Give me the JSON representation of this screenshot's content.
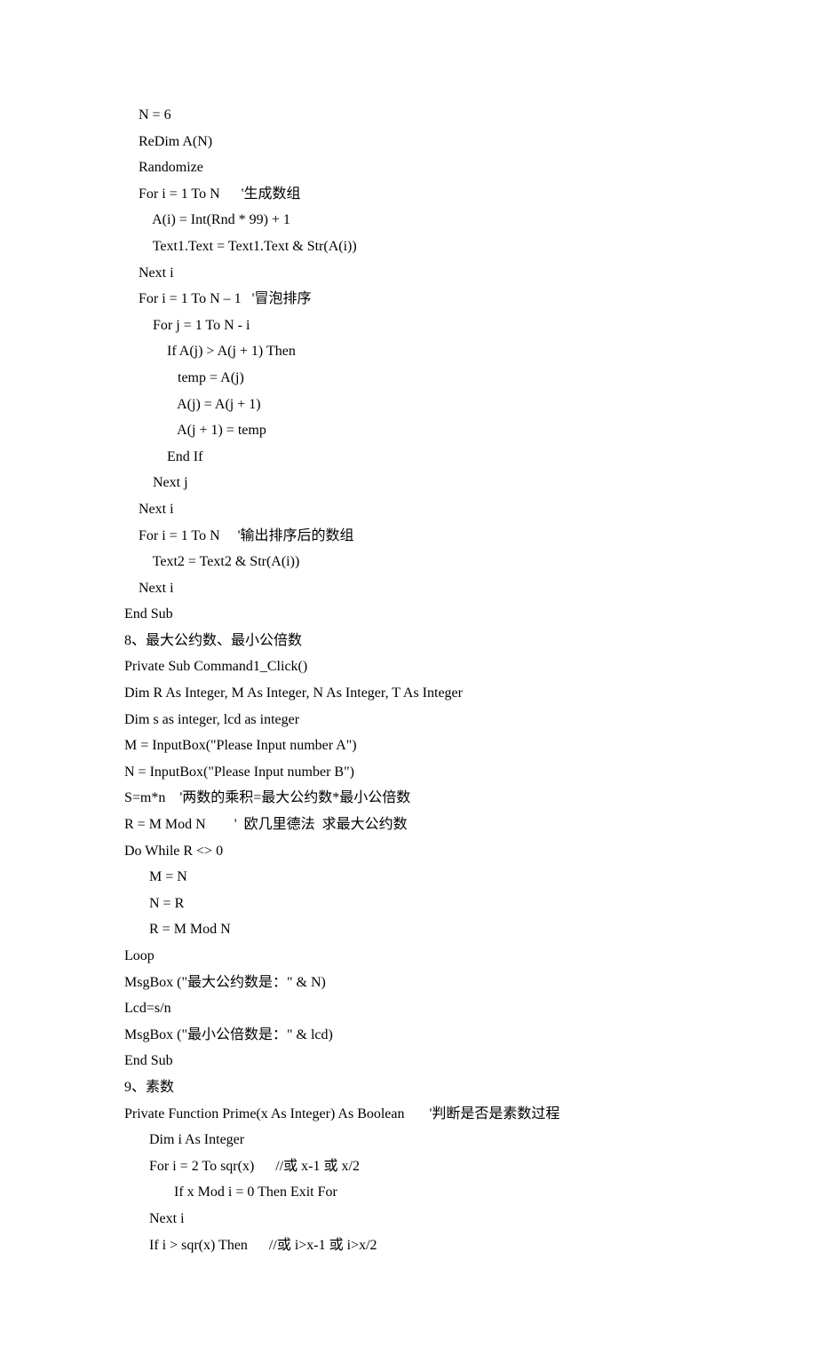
{
  "lines": [
    "    N = 6",
    "    ReDim A(N)",
    "    Randomize",
    "    For i = 1 To N      '生成数组",
    "        A(i) = Int(Rnd * 99) + 1",
    "        Text1.Text = Text1.Text & Str(A(i))",
    "    Next i",
    "    For i = 1 To N – 1   '冒泡排序",
    "        For j = 1 To N - i",
    "            If A(j) > A(j + 1) Then",
    "               temp = A(j)",
    "               A(j) = A(j + 1)",
    "               A(j + 1) = temp",
    "            End If",
    "        Next j",
    "    Next i",
    "    For i = 1 To N     '输出排序后的数组",
    "        Text2 = Text2 & Str(A(i))",
    "    Next i",
    "End Sub",
    "8、最大公约数、最小公倍数",
    "Private Sub Command1_Click()",
    "Dim R As Integer, M As Integer, N As Integer, T As Integer",
    "Dim s as integer, lcd as integer",
    "M = InputBox(\"Please Input number A\")",
    "N = InputBox(\"Please Input number B\")",
    "S=m*n    '两数的乘积=最大公约数*最小公倍数",
    "R = M Mod N        '  欧几里德法  求最大公约数",
    "Do While R <> 0",
    "       M = N",
    "       N = R",
    "       R = M Mod N",
    "Loop",
    "MsgBox (\"最大公约数是：\" & N)",
    "Lcd=s/n",
    "MsgBox (\"最小公倍数是：\" & lcd)",
    "End Sub",
    "9、素数",
    "Private Function Prime(x As Integer) As Boolean       '判断是否是素数过程",
    "       Dim i As Integer",
    "       For i = 2 To sqr(x)      //或 x-1 或 x/2",
    "              If x Mod i = 0 Then Exit For",
    "       Next i",
    "       If i > sqr(x) Then      //或 i>x-1 或 i>x/2"
  ]
}
